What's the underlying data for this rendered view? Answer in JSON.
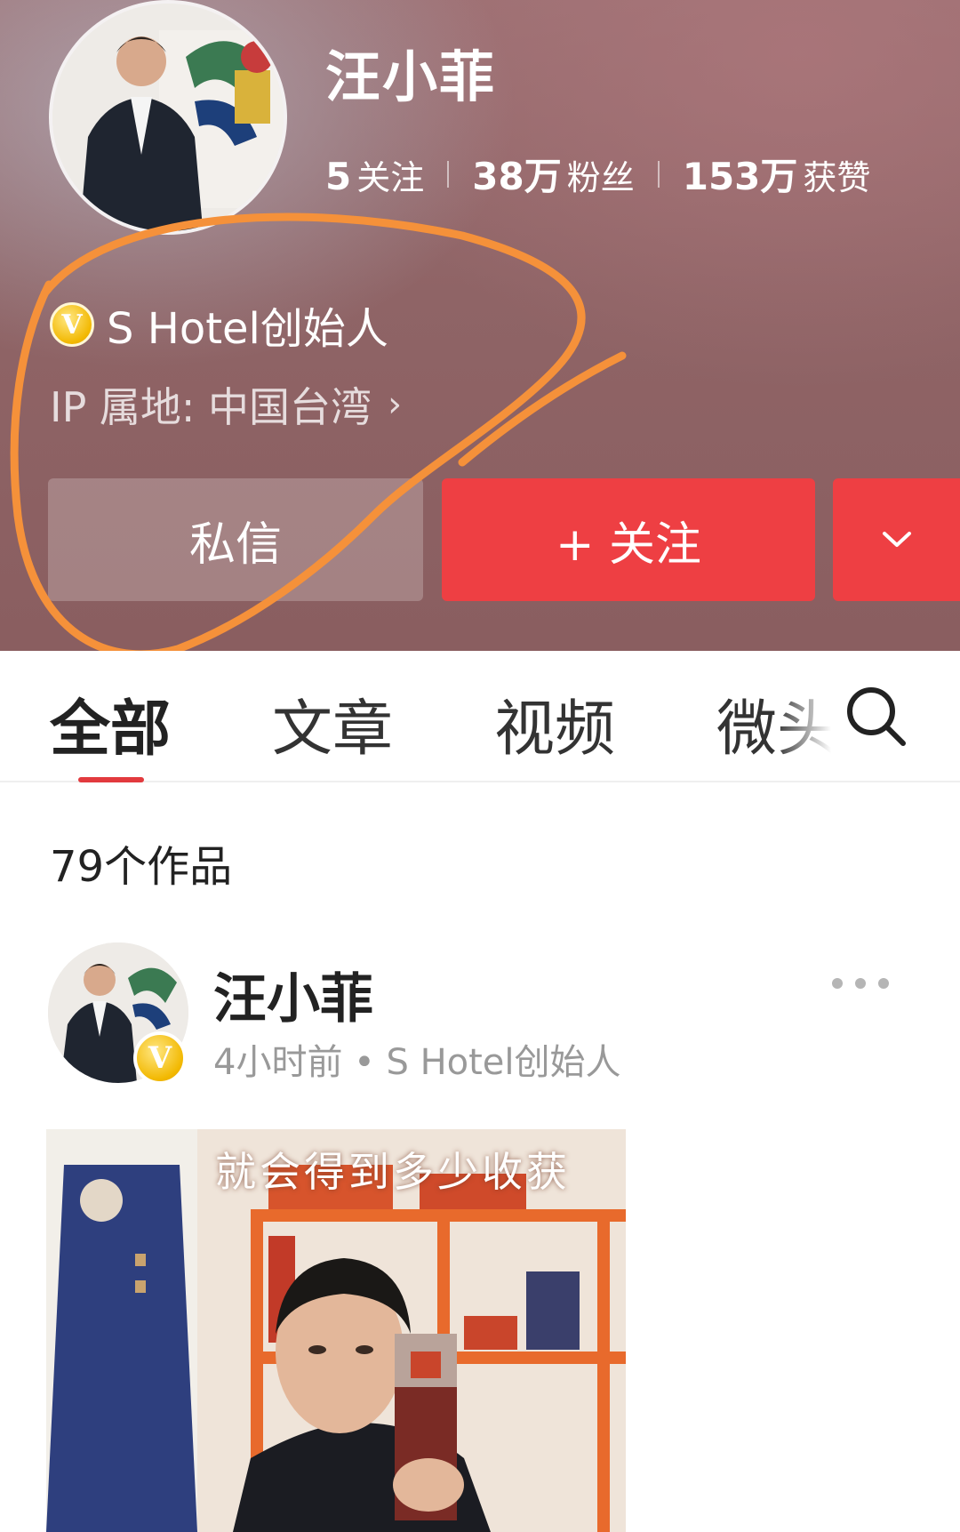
{
  "profile": {
    "name": "汪小菲",
    "stats": [
      {
        "value": "5",
        "label": "关注"
      },
      {
        "value": "38万",
        "label": "粉丝"
      },
      {
        "value": "153万",
        "label": "获赞"
      }
    ],
    "verify_badge": "V",
    "verified_title": "S Hotel创始人",
    "ip_location": "IP 属地: 中国台湾",
    "ip_chevron": "›"
  },
  "actions": {
    "message_label": "私信",
    "follow_label": "+ 关注",
    "more_icon": "chevron-down-icon"
  },
  "tabs": [
    {
      "label": "全部",
      "active": true
    },
    {
      "label": "文章",
      "active": false
    },
    {
      "label": "视频",
      "active": false
    },
    {
      "label": "微头",
      "active": false
    }
  ],
  "works_count": "79个作品",
  "post": {
    "author": "汪小菲",
    "badge": "V",
    "meta": "4小时前 • S Hotel创始人",
    "video_caption": "就会得到多少收获"
  },
  "colors": {
    "accent_red": "#ee3f43",
    "header_bg": "#8f6466",
    "annotation_orange": "#f5913a",
    "verify_gold": "#f2b800"
  }
}
